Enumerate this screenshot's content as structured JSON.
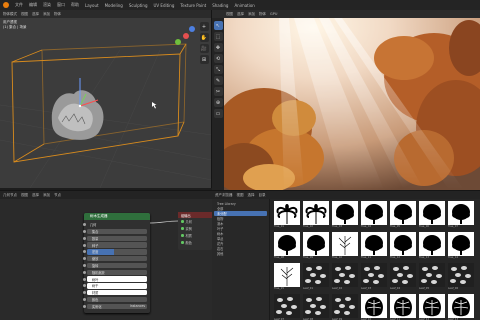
{
  "menu": [
    "文件",
    "编辑",
    "渲染",
    "窗口",
    "帮助",
    "Layout",
    "Modeling",
    "Sculpting",
    "UV Editing",
    "Texture Paint",
    "Shading",
    "Animation"
  ],
  "viewport3d": {
    "header": [
      "物体模式",
      "视图",
      "选择",
      "添加",
      "物体"
    ],
    "info": [
      "用户透视",
      "(1) 集合 | 场景"
    ],
    "tools": [
      "+",
      "✋",
      "🎥",
      "⊞"
    ]
  },
  "render": {
    "header": [
      "视图",
      "选择",
      "添加",
      "物体",
      "GPU"
    ],
    "tools": [
      "↖",
      "⬚",
      "✥",
      "⟲",
      "⤡",
      "✎",
      "✂",
      "⊕",
      "▭"
    ]
  },
  "nodeeditor": {
    "header": [
      "几何节点",
      "视图",
      "选择",
      "添加",
      "节点"
    ],
    "node_title": "树木生成器",
    "rows": [
      {
        "label": "几何",
        "kind": "plain"
      },
      {
        "label": "集合",
        "kind": "gray"
      },
      {
        "label": "数量",
        "kind": "gray",
        "value": ""
      },
      {
        "label": "种子",
        "kind": "gray",
        "value": ""
      },
      {
        "label": "密度",
        "kind": "blue"
      },
      {
        "label": "缩放",
        "kind": "gray"
      },
      {
        "label": "旋转",
        "kind": "gray"
      },
      {
        "label": "随机缩放",
        "kind": "gray"
      },
      {
        "label": "树叶",
        "kind": "white"
      },
      {
        "label": "树干",
        "kind": "white"
      },
      {
        "label": "材质",
        "kind": "white"
      },
      {
        "label": "颜色",
        "kind": "gray"
      },
      {
        "label": "实例化",
        "kind": "gray",
        "value": "Instances"
      }
    ],
    "output_node": {
      "title": "组输出",
      "rows": [
        "几何",
        "实例",
        "材质",
        "颜色"
      ]
    }
  },
  "assets": {
    "header": [
      "资产浏览器",
      "视图",
      "选择",
      "目录"
    ],
    "side": [
      {
        "label": "Tree Library",
        "selected": false
      },
      {
        "label": "全部",
        "selected": false
      },
      {
        "label": "未分配",
        "selected": true
      },
      {
        "label": "植物",
        "selected": false
      },
      {
        "label": "灌木",
        "selected": false
      },
      {
        "label": "叶子",
        "selected": false
      },
      {
        "label": "树木",
        "selected": false
      },
      {
        "label": "草丛",
        "selected": false
      },
      {
        "label": "花卉",
        "selected": false
      },
      {
        "label": "岩石",
        "selected": false
      },
      {
        "label": "其他",
        "selected": false
      }
    ],
    "tiles": [
      {
        "label": "Tree_01",
        "kind": "palm"
      },
      {
        "label": "Tree_02",
        "kind": "palm"
      },
      {
        "label": "Tree_03",
        "kind": "bush"
      },
      {
        "label": "Tree_04",
        "kind": "bush"
      },
      {
        "label": "Tree_05",
        "kind": "bush"
      },
      {
        "label": "Tree_06",
        "kind": "bush"
      },
      {
        "label": "Tree_07",
        "kind": "bush"
      },
      {
        "label": "Tree_08",
        "kind": "bush"
      },
      {
        "label": "Tree_09",
        "kind": "bush"
      },
      {
        "label": "Tree_10",
        "kind": "twig"
      },
      {
        "label": "Tree_11",
        "kind": "bush"
      },
      {
        "label": "Tree_12",
        "kind": "bush"
      },
      {
        "label": "Tree_13",
        "kind": "bush"
      },
      {
        "label": "Tree_14",
        "kind": "bush"
      },
      {
        "label": "Tree_15",
        "kind": "twig"
      },
      {
        "label": "Leaf_01",
        "kind": "dark"
      },
      {
        "label": "Leaf_02",
        "kind": "dark"
      },
      {
        "label": "Leaf_03",
        "kind": "dark"
      },
      {
        "label": "Leaf_04",
        "kind": "dark"
      },
      {
        "label": "Leaf_05",
        "kind": "dark"
      },
      {
        "label": "Leaf_06",
        "kind": "dark"
      },
      {
        "label": "Leaf_07",
        "kind": "dark"
      },
      {
        "label": "Leaf_08",
        "kind": "dark"
      },
      {
        "label": "Leaf_09",
        "kind": "dark"
      },
      {
        "label": "Leaf_10",
        "kind": "monstera"
      },
      {
        "label": "Leaf_11",
        "kind": "monstera"
      },
      {
        "label": "Leaf_12",
        "kind": "monstera"
      },
      {
        "label": "Leaf_13",
        "kind": "monstera"
      }
    ]
  },
  "colors": {
    "accent": "#4772b3",
    "selection": "#e87d0d",
    "node_header": "#2f6f3c"
  }
}
